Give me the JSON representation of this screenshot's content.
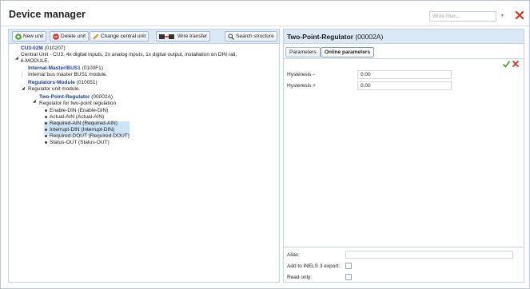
{
  "window": {
    "title": "Device manager",
    "filter_placeholder": "Write filter...",
    "filter_dropdown_glyph": "▾"
  },
  "toolbar": {
    "new_unit": "New unit",
    "delete_unit": "Delete unit",
    "change_central_unit": "Change central unit",
    "wire_transfer": "Wire transfer",
    "search_structure": "Search structure"
  },
  "tree": {
    "root": {
      "name": "CU3-02M",
      "code": "(010207)",
      "desc1": "Central Unit - CU3, 4x digital inputs, 2x analog inputs, 1x digital output, installation on DIN rail,",
      "desc2": "6-MODULE."
    },
    "bus": {
      "name": "Internal-Master/BUS1",
      "code": "(0100F1)",
      "desc": "Internal bus master BUS1 module."
    },
    "regmod": {
      "name": "Regulators-Module",
      "code": "(010051)",
      "desc": "Regulator unit module."
    },
    "tpr": {
      "name": "Two-Point-Regulator",
      "code": "(00002A)",
      "desc": "Regulator for two-point regulation"
    },
    "signals": [
      "Enable-DIN (Enable-DIN)",
      "Actual-AIN (Actual-AIN)",
      "Required-AIN (Required-AIN)",
      "Interrupt-DIN (Interrupt-DIN)",
      "Required-DOUT (Required-DOUT)",
      "Status-OUT (Status-OUT)"
    ]
  },
  "detail": {
    "title": "Two-Point-Regulator",
    "code": "(00002A)",
    "tabs": [
      "Parameters",
      "Online parameters"
    ],
    "active_tab": "Online parameters",
    "params": [
      {
        "label": "Hysteresis -",
        "value": "0.00"
      },
      {
        "label": "Hysteresis +",
        "value": "0.00"
      }
    ],
    "alias_label": "Alias:",
    "alias_value": "",
    "export_label": "Add to iNELS 3 export:",
    "export_checked": false,
    "readonly_label": "Read only:",
    "readonly_checked": false
  },
  "colors": {
    "accent_header": "#dbe9f6",
    "tree_bold": "#1c3f94",
    "ok_green": "#4aa03a",
    "close_red": "#d9302a"
  }
}
